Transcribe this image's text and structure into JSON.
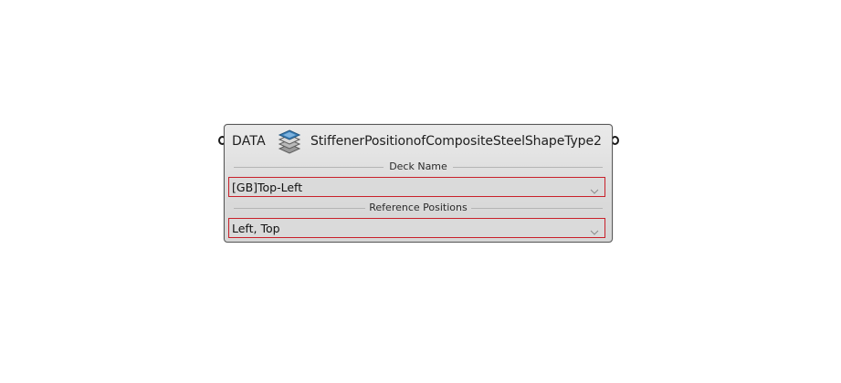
{
  "node": {
    "category_label": "DATA",
    "icon": "layers-stack-icon",
    "title": "StiffenerPositionofCompositeSteelShapeType2",
    "inputs": [
      {
        "section_label": "Deck Name",
        "selected_value": "[GB]Top-Left",
        "control_icon": "chevron-down-icon"
      },
      {
        "section_label": "Reference Positions",
        "selected_value": "Left, Top",
        "control_icon": "chevron-down-icon"
      }
    ]
  },
  "colors": {
    "node_border": "#5a5a5a",
    "dropdown_border": "#c8202a",
    "node_fill": "#dadada",
    "icon_blue": "#3a7fb8"
  }
}
